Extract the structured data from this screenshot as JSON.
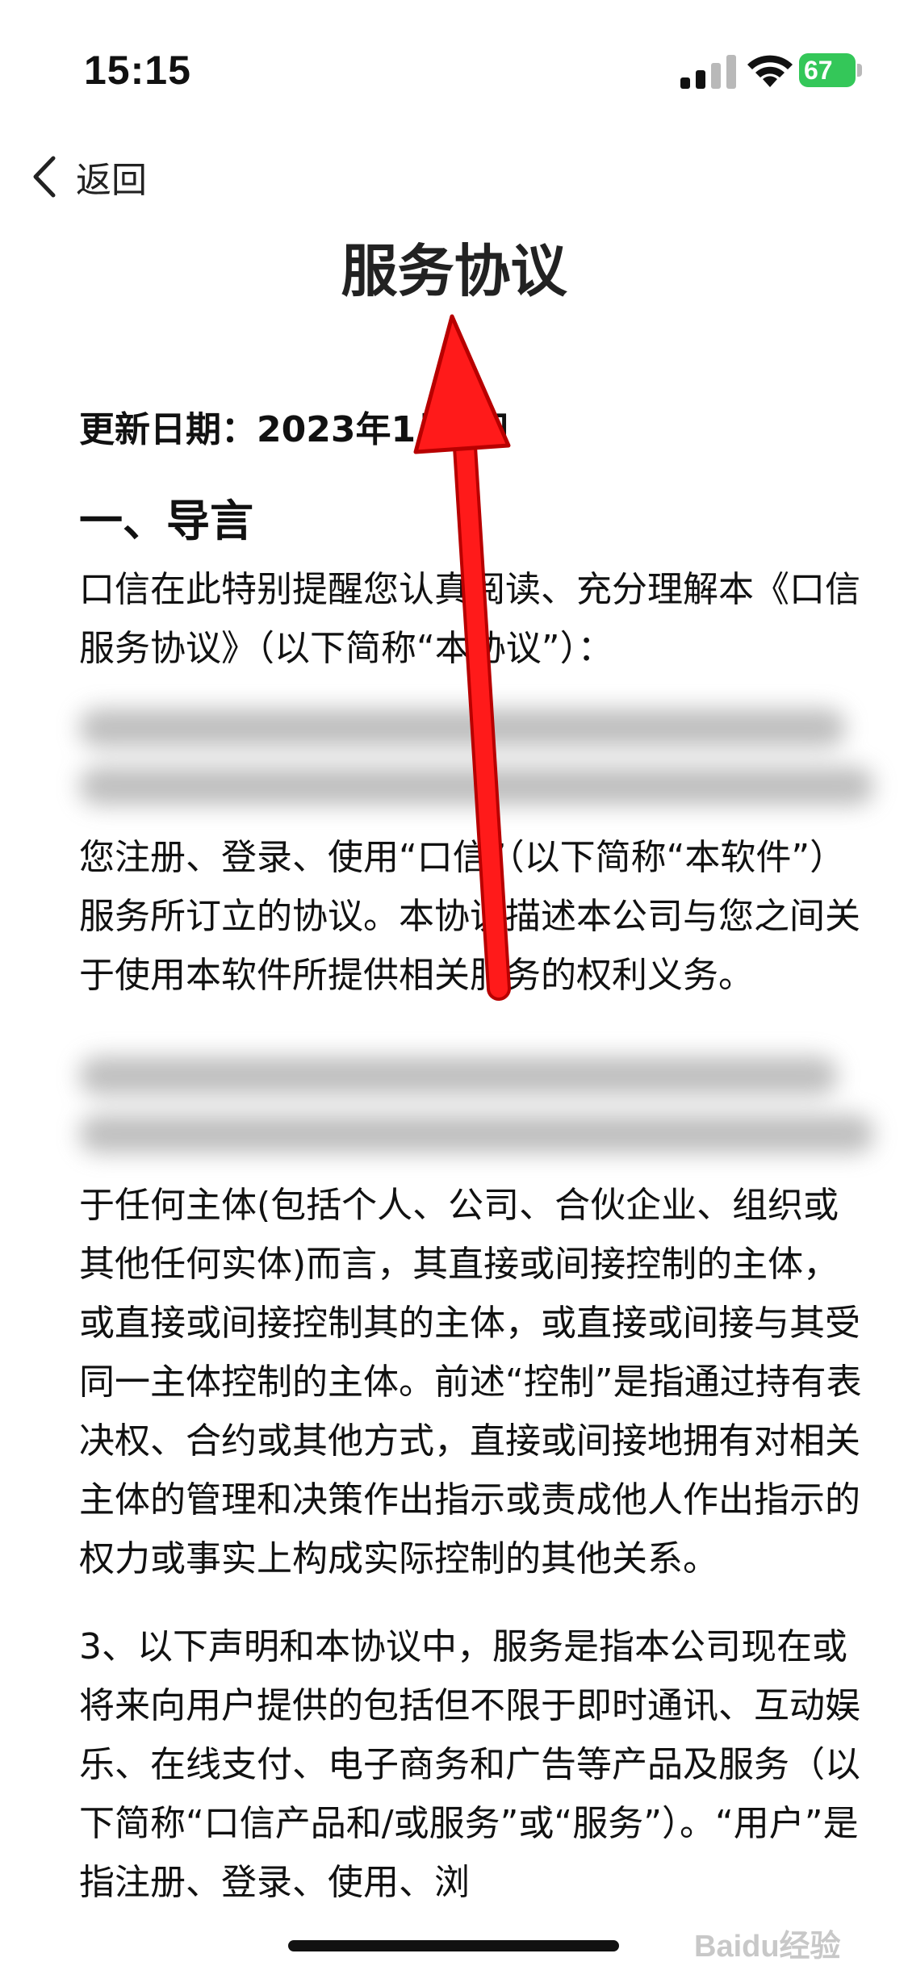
{
  "status_bar": {
    "time": "15:15",
    "battery_level": "67",
    "icons": [
      "signal-icon",
      "wifi-icon",
      "battery-icon"
    ],
    "battery_color": "#34c759"
  },
  "nav": {
    "back_label": "返回",
    "title": "服务协议"
  },
  "article": {
    "update_date": "更新日期：2023年1月1日",
    "section_heading": "一、导言",
    "paragraphs": [
      "口信在此特别提醒您认真阅读、充分理解本《口信服务协议》（以下简称“本协议”）：",
      "您注册、登录、使用“口信”（以下简称“本软件”）服务所订立的协议。本协议描述本公司与您之间关于使用本软件所提供相关服务的权利义务。",
      "于任何主体(包括个人、公司、合伙企业、组织或其他任何实体)而言，其直接或间接控制的主体，或直接或间接控制其的主体，或直接或间接与其受同一主体控制的主体。前述“控制”是指通过持有表决权、合约或其他方式，直接或间接地拥有对相关主体的管理和决策作出指示或责成他人作出指示的权力或事实上构成实际控制的其他关系。",
      "3、以下声明和本协议中，服务是指本公司现在或将来向用户提供的包括但不限于即时通讯、互动娱乐、在线支付、电子商务和广告等产品及服务（以下简称“口信产品和/或服务”或“服务”）。“用户”是指注册、登录、使用、浏"
    ]
  },
  "overlay": {
    "arrow_color": "#ff1a1a",
    "arrow_direction": "up"
  },
  "watermark": "Baidu经验"
}
